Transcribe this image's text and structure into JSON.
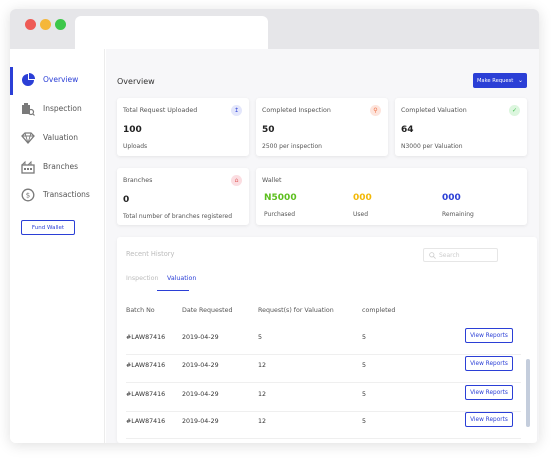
{
  "sidebar": {
    "items": [
      {
        "label": "Overview",
        "icon": "pie-chart-icon",
        "active": true
      },
      {
        "label": "Inspection",
        "icon": "inspection-icon"
      },
      {
        "label": "Valuation",
        "icon": "diamond-icon"
      },
      {
        "label": "Branches",
        "icon": "building-icon"
      },
      {
        "label": "Transactions",
        "icon": "dollar-circle-icon"
      }
    ],
    "fund_wallet": "Fund Wallet"
  },
  "header": {
    "title": "Overview",
    "make_request": "Make Request"
  },
  "cards": {
    "total_request": {
      "title": "Total Request Uploaded",
      "value": "100",
      "sub": "Uploads"
    },
    "completed_inspection": {
      "title": "Completed Inspection",
      "value": "50",
      "sub": "2500 per inspection"
    },
    "completed_valuation": {
      "title": "Completed Valuation",
      "value": "64",
      "sub": "N3000 per Valuation"
    },
    "branches": {
      "title": "Branches",
      "value": "0",
      "sub": "Total number of branches registered"
    },
    "wallet": {
      "title": "Wallet",
      "purchased": {
        "value": "N5000",
        "label": "Purchased",
        "color": "#5cbf1e"
      },
      "used": {
        "value": "000",
        "label": "Used",
        "color": "#f2b807"
      },
      "remaining": {
        "value": "000",
        "label": "Remaining",
        "color": "#2b3fd6"
      }
    }
  },
  "history": {
    "title": "Recent History",
    "search_placeholder": "Search",
    "tabs": [
      "Inspection",
      "Valuation"
    ],
    "active_tab": "Valuation",
    "columns": [
      "Batch No",
      "Date Requested",
      "Request(s)  for Valuation",
      "completed"
    ],
    "rows": [
      {
        "batch": "#LAW87416",
        "date": "2019-04-29",
        "requests": "5",
        "completed": "5",
        "action": "View Reports"
      },
      {
        "batch": "#LAW87416",
        "date": "2019-04-29",
        "requests": "12",
        "completed": "5",
        "action": "View Reports"
      },
      {
        "batch": "#LAW87416",
        "date": "2019-04-29",
        "requests": "12",
        "completed": "5",
        "action": "View Reports"
      },
      {
        "batch": "#LAW87416",
        "date": "2019-04-29",
        "requests": "12",
        "completed": "5",
        "action": "View Reports"
      }
    ]
  },
  "colors": {
    "accent": "#2b3fd6",
    "green": "#5cbf1e",
    "yellow": "#f2b807",
    "red": "#e05a5a"
  }
}
